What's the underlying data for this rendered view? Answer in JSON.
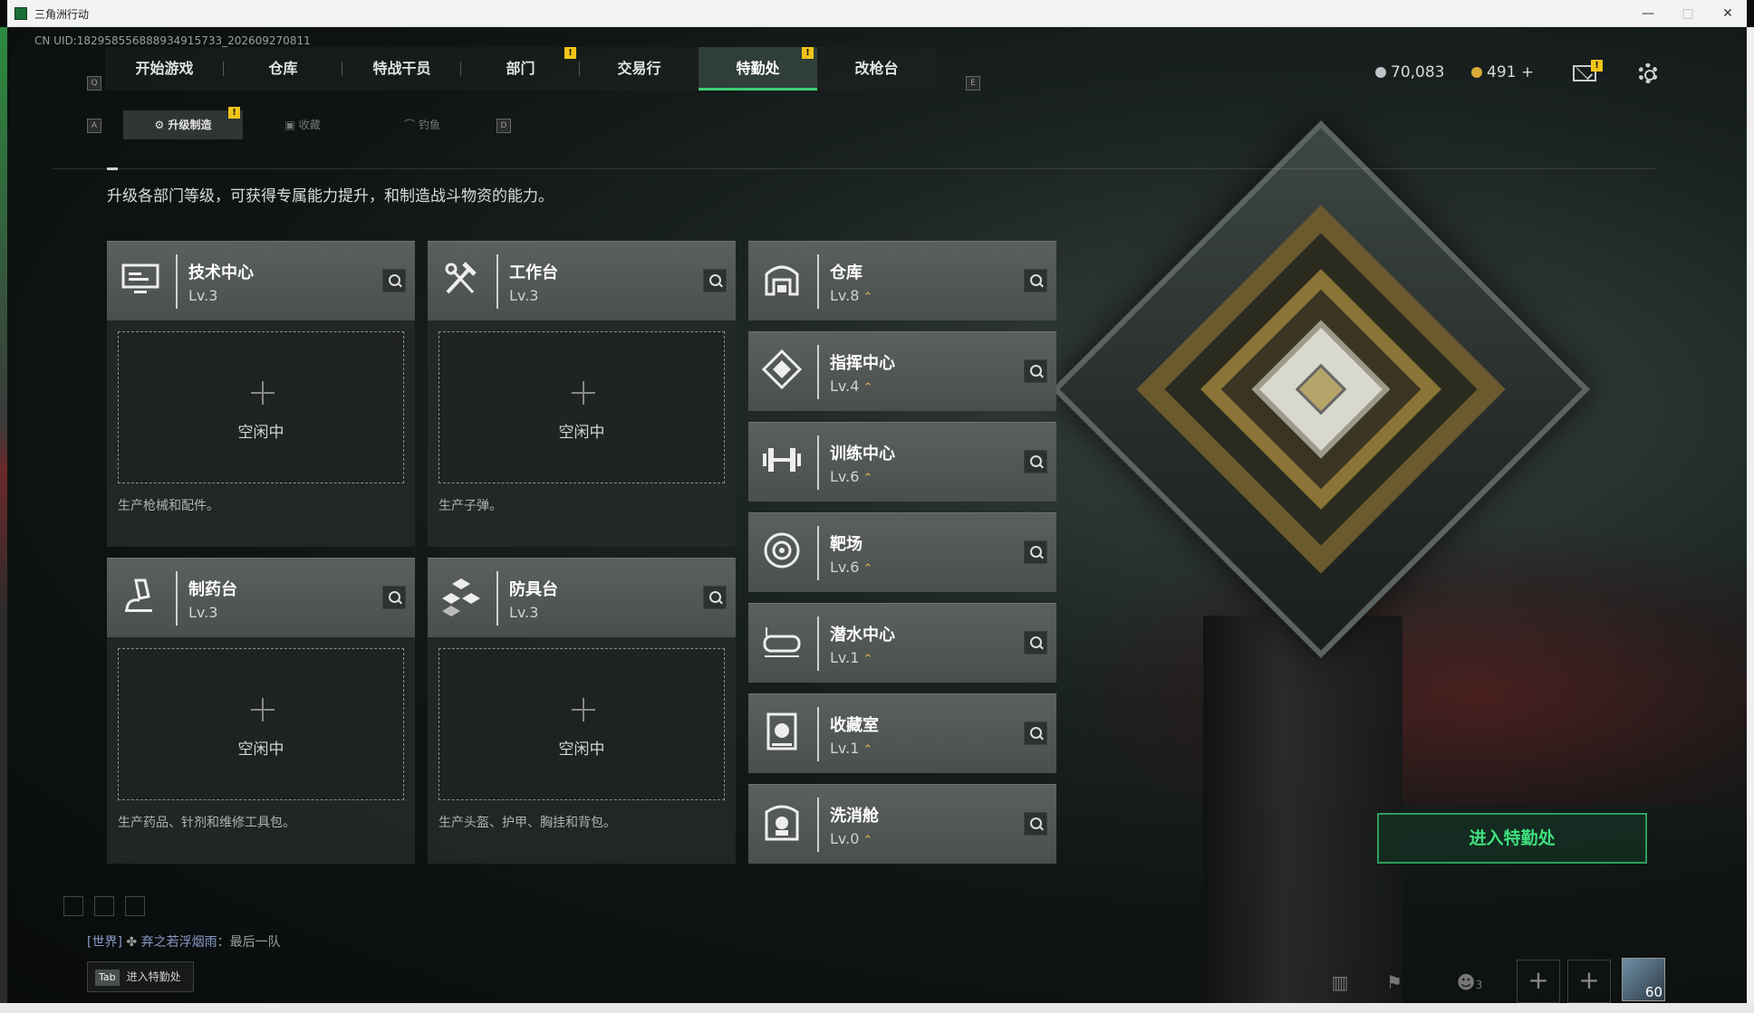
{
  "window": {
    "title": "三角洲行动",
    "min": "—",
    "max": "□",
    "close": "✕"
  },
  "uid": "CN UID:1829585568889349157​33_202609270811",
  "nav": {
    "left_key": "Q",
    "right_key": "E",
    "tabs": [
      "开始游戏",
      "仓库",
      "特战干员",
      "部门",
      "交易行",
      "特勤处",
      "改枪台"
    ],
    "active": "特勤处",
    "badge": "!"
  },
  "subnav": {
    "left_key": "A",
    "right_key": "D",
    "tabs": [
      "升级制造",
      "收藏",
      "钓鱼"
    ],
    "active": "升级制造"
  },
  "currency": {
    "silver": "70,083",
    "gold": "491",
    "gold_plus": "+"
  },
  "description": "升级各部门等级，可获得专属能力提升，和制造战斗物资的能力。",
  "production": [
    {
      "name": "技术中心",
      "level": "Lv.3",
      "status": "空闲中",
      "desc": "生产枪械和配件。",
      "icon": "computer-icon"
    },
    {
      "name": "工作台",
      "level": "Lv.3",
      "status": "空闲中",
      "desc": "生产子弹。",
      "icon": "tools-icon"
    },
    {
      "name": "制药台",
      "level": "Lv.3",
      "status": "空闲中",
      "desc": "生产药品、针剂和维修工具包。",
      "icon": "microscope-icon"
    },
    {
      "name": "防具台",
      "level": "Lv.3",
      "status": "空闲中",
      "desc": "生产头盔、护甲、胸挂和背包。",
      "icon": "armor-icon"
    }
  ],
  "facilities": [
    {
      "name": "仓库",
      "level": "Lv.8",
      "icon": "warehouse-icon"
    },
    {
      "name": "指挥中心",
      "level": "Lv.4",
      "icon": "command-icon"
    },
    {
      "name": "训练中心",
      "level": "Lv.6",
      "icon": "dumbbell-icon"
    },
    {
      "name": "靶场",
      "level": "Lv.6",
      "icon": "target-icon"
    },
    {
      "name": "潜水中心",
      "level": "Lv.1",
      "icon": "goggles-icon"
    },
    {
      "name": "收藏室",
      "level": "Lv.1",
      "icon": "collection-icon"
    },
    {
      "name": "洗消舱",
      "level": "Lv.0",
      "icon": "decon-icon"
    }
  ],
  "upgrade_glyph": "⌃",
  "enter_button": "进入特勤处",
  "chat": {
    "channel": "[世界]",
    "user": "弃之若浮烟雨",
    "message": "：最后一队"
  },
  "tab_hint": {
    "key": "Tab",
    "label": "进入特勤处"
  },
  "bottom": {
    "squad_count": "3",
    "avatar_level": "60"
  },
  "colors": {
    "accent": "#3ecf74",
    "badge": "#f0c419",
    "upgrade": "#e0b94b"
  }
}
